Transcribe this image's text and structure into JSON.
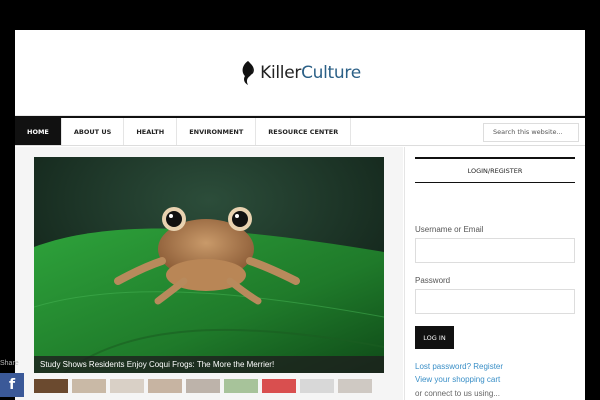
{
  "site": {
    "logo_part1": "Killer",
    "logo_part2": "Culture",
    "brand_color": "#2a5f86"
  },
  "nav": {
    "items": [
      "HOME",
      "ABOUT US",
      "HEALTH",
      "ENVIRONMENT",
      "RESOURCE CENTER"
    ],
    "active": "HOME"
  },
  "search": {
    "placeholder": "Search this website..."
  },
  "feature": {
    "caption": "Study Shows Residents Enjoy Coqui Frogs: The More the Merrier!",
    "image": "frog-photo"
  },
  "sidebar": {
    "widget_title": "LOGIN/REGISTER",
    "username_label": "Username or Email",
    "password_label": "Password",
    "login_button": "LOG IN",
    "lost_password_link": "Lost password? Register",
    "cart_link": "View your shopping cart",
    "connect_text": "or connect to us using..."
  },
  "share": {
    "label": "Share",
    "facebook_icon": "facebook-icon"
  },
  "colors": {
    "nav_active_bg": "#111111",
    "link": "#3a8fc7",
    "facebook": "#3b5998"
  }
}
